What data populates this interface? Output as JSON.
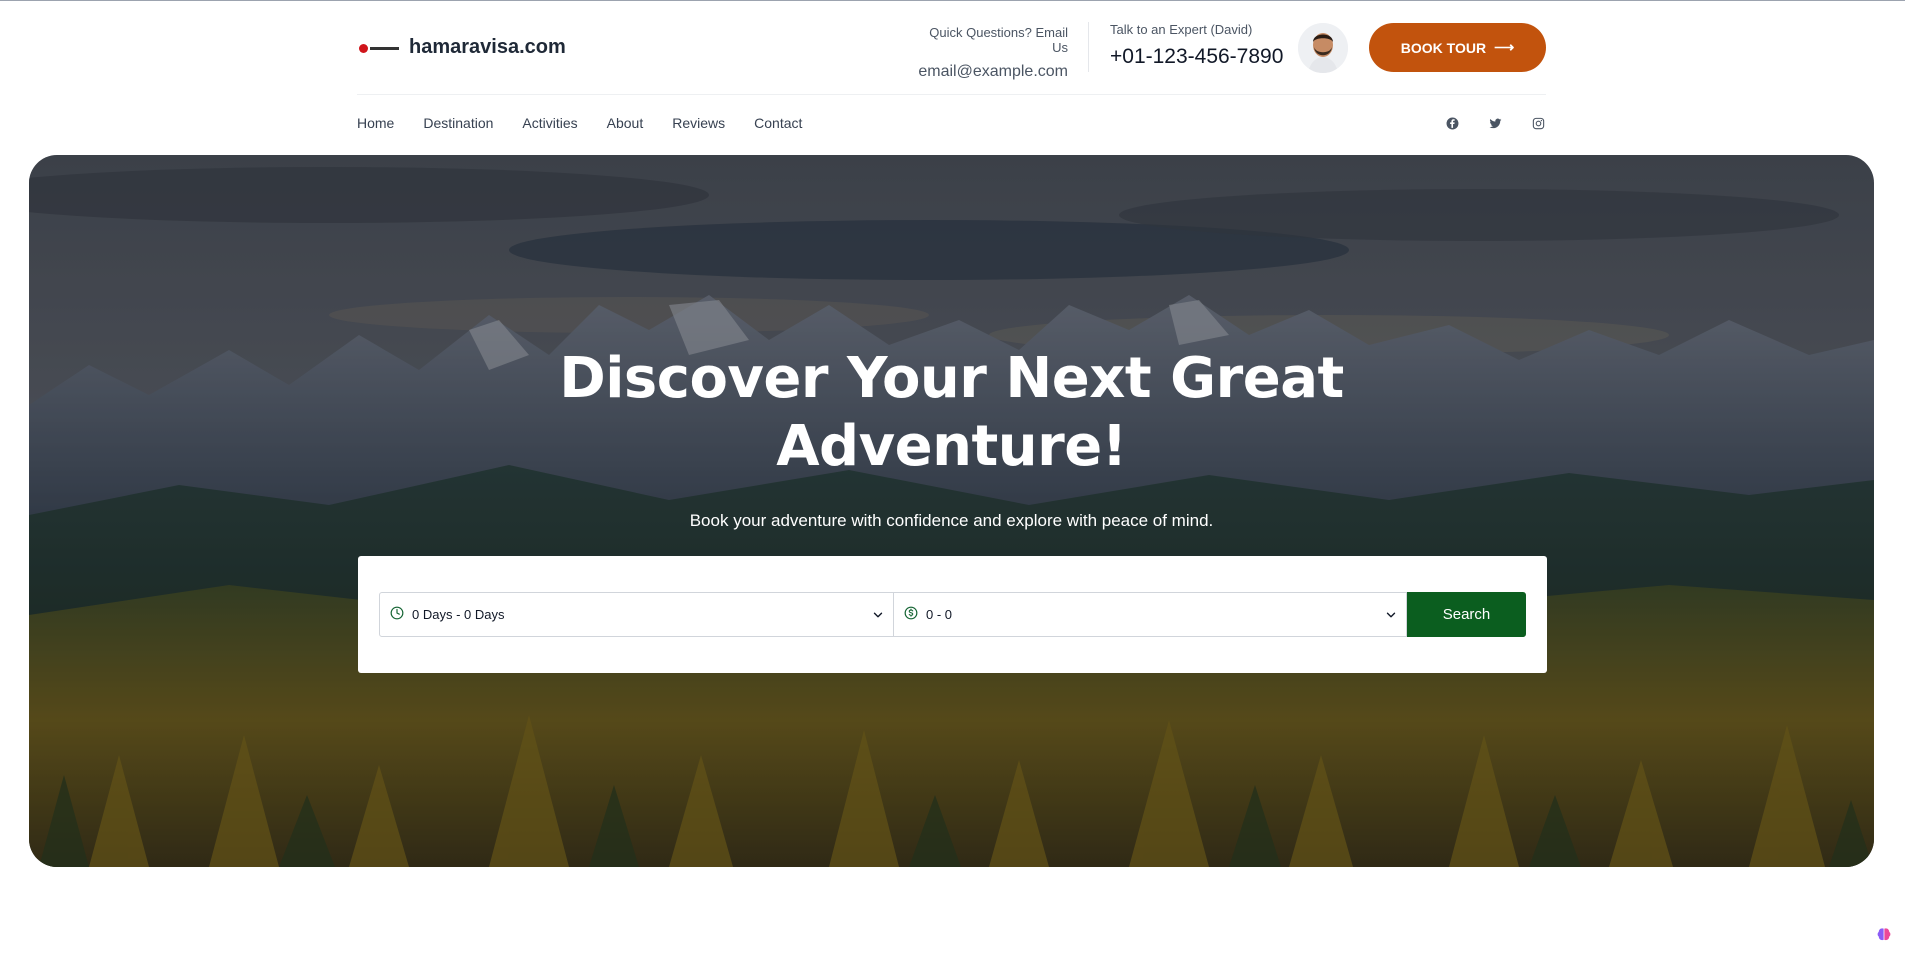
{
  "header": {
    "logo_text": "hamaravisa.com",
    "email_label": "Quick Questions? Email Us",
    "email_value": "email@example.com",
    "expert_label": "Talk to an Expert (David)",
    "expert_phone": "+01-123-456-7890",
    "book_button": "BOOK TOUR",
    "book_arrow": "⟶"
  },
  "nav": {
    "items": [
      "Home",
      "Destination",
      "Activities",
      "About",
      "Reviews",
      "Contact"
    ]
  },
  "socials": [
    "facebook-icon",
    "twitter-icon",
    "instagram-icon"
  ],
  "hero": {
    "title_line1": "Discover Your Next Great",
    "title_line2": "Adventure!",
    "subtitle": "Book your adventure with confidence and explore with peace of mind."
  },
  "search": {
    "days_value": "0 Days - 0 Days",
    "price_value": "0 - 0",
    "button": "Search"
  },
  "colors": {
    "accent": "#c2530d",
    "search_button": "#0b5e1f",
    "icon_green": "#166534"
  }
}
